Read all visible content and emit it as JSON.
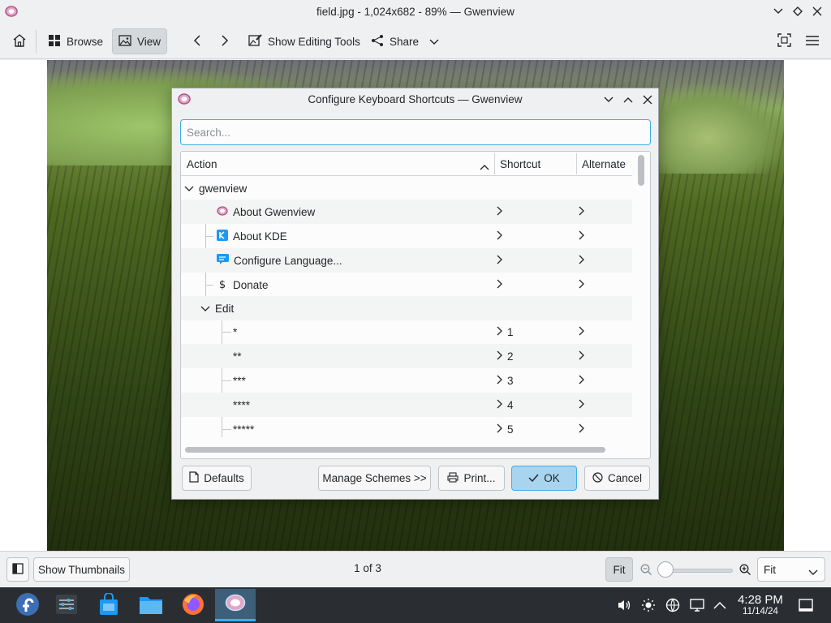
{
  "window": {
    "title": "field.jpg - 1,024x682 - 89% — Gwenview"
  },
  "toolbar": {
    "browse_label": "Browse",
    "view_label": "View",
    "editing_tools_label": "Show Editing Tools",
    "share_label": "Share"
  },
  "bottombar": {
    "thumbnails_label": "Show Thumbnails",
    "page_indicator": "1 of 3",
    "fit_button_label": "Fit",
    "zoom_select_value": "Fit",
    "zoom_slider_fraction": 0.0
  },
  "dialog": {
    "title": "Configure Keyboard Shortcuts — Gwenview",
    "search_placeholder": "Search...",
    "columns": {
      "action": "Action",
      "shortcut": "Shortcut",
      "alternate": "Alternate"
    },
    "rows": [
      {
        "label": "gwenview",
        "shortcut": "",
        "icon": "chevron-down-icon"
      },
      {
        "label": "About Gwenview",
        "shortcut": "",
        "icon": "gwenview-icon"
      },
      {
        "label": "About KDE",
        "shortcut": "",
        "icon": "kde-icon"
      },
      {
        "label": "Configure Language...",
        "shortcut": "",
        "icon": "language-icon"
      },
      {
        "label": "Donate",
        "shortcut": "",
        "icon": "dollar-icon"
      },
      {
        "label": "Edit",
        "shortcut": "",
        "icon": "chevron-down-icon"
      },
      {
        "label": "*",
        "shortcut": "1",
        "icon": ""
      },
      {
        "label": "**",
        "shortcut": "2",
        "icon": ""
      },
      {
        "label": "***",
        "shortcut": "3",
        "icon": ""
      },
      {
        "label": "****",
        "shortcut": "4",
        "icon": ""
      },
      {
        "label": "*****",
        "shortcut": "5",
        "icon": ""
      }
    ],
    "buttons": {
      "defaults": "Defaults",
      "manage_schemes": "Manage Schemes >>",
      "print": "Print...",
      "ok": "OK",
      "cancel": "Cancel"
    }
  },
  "taskbar": {
    "time": "4:28 PM",
    "date": "11/14/24"
  },
  "colors": {
    "accent": "#3daee9",
    "taskbar_bg": "#2a2e32",
    "window_bg": "#eff0f1"
  }
}
